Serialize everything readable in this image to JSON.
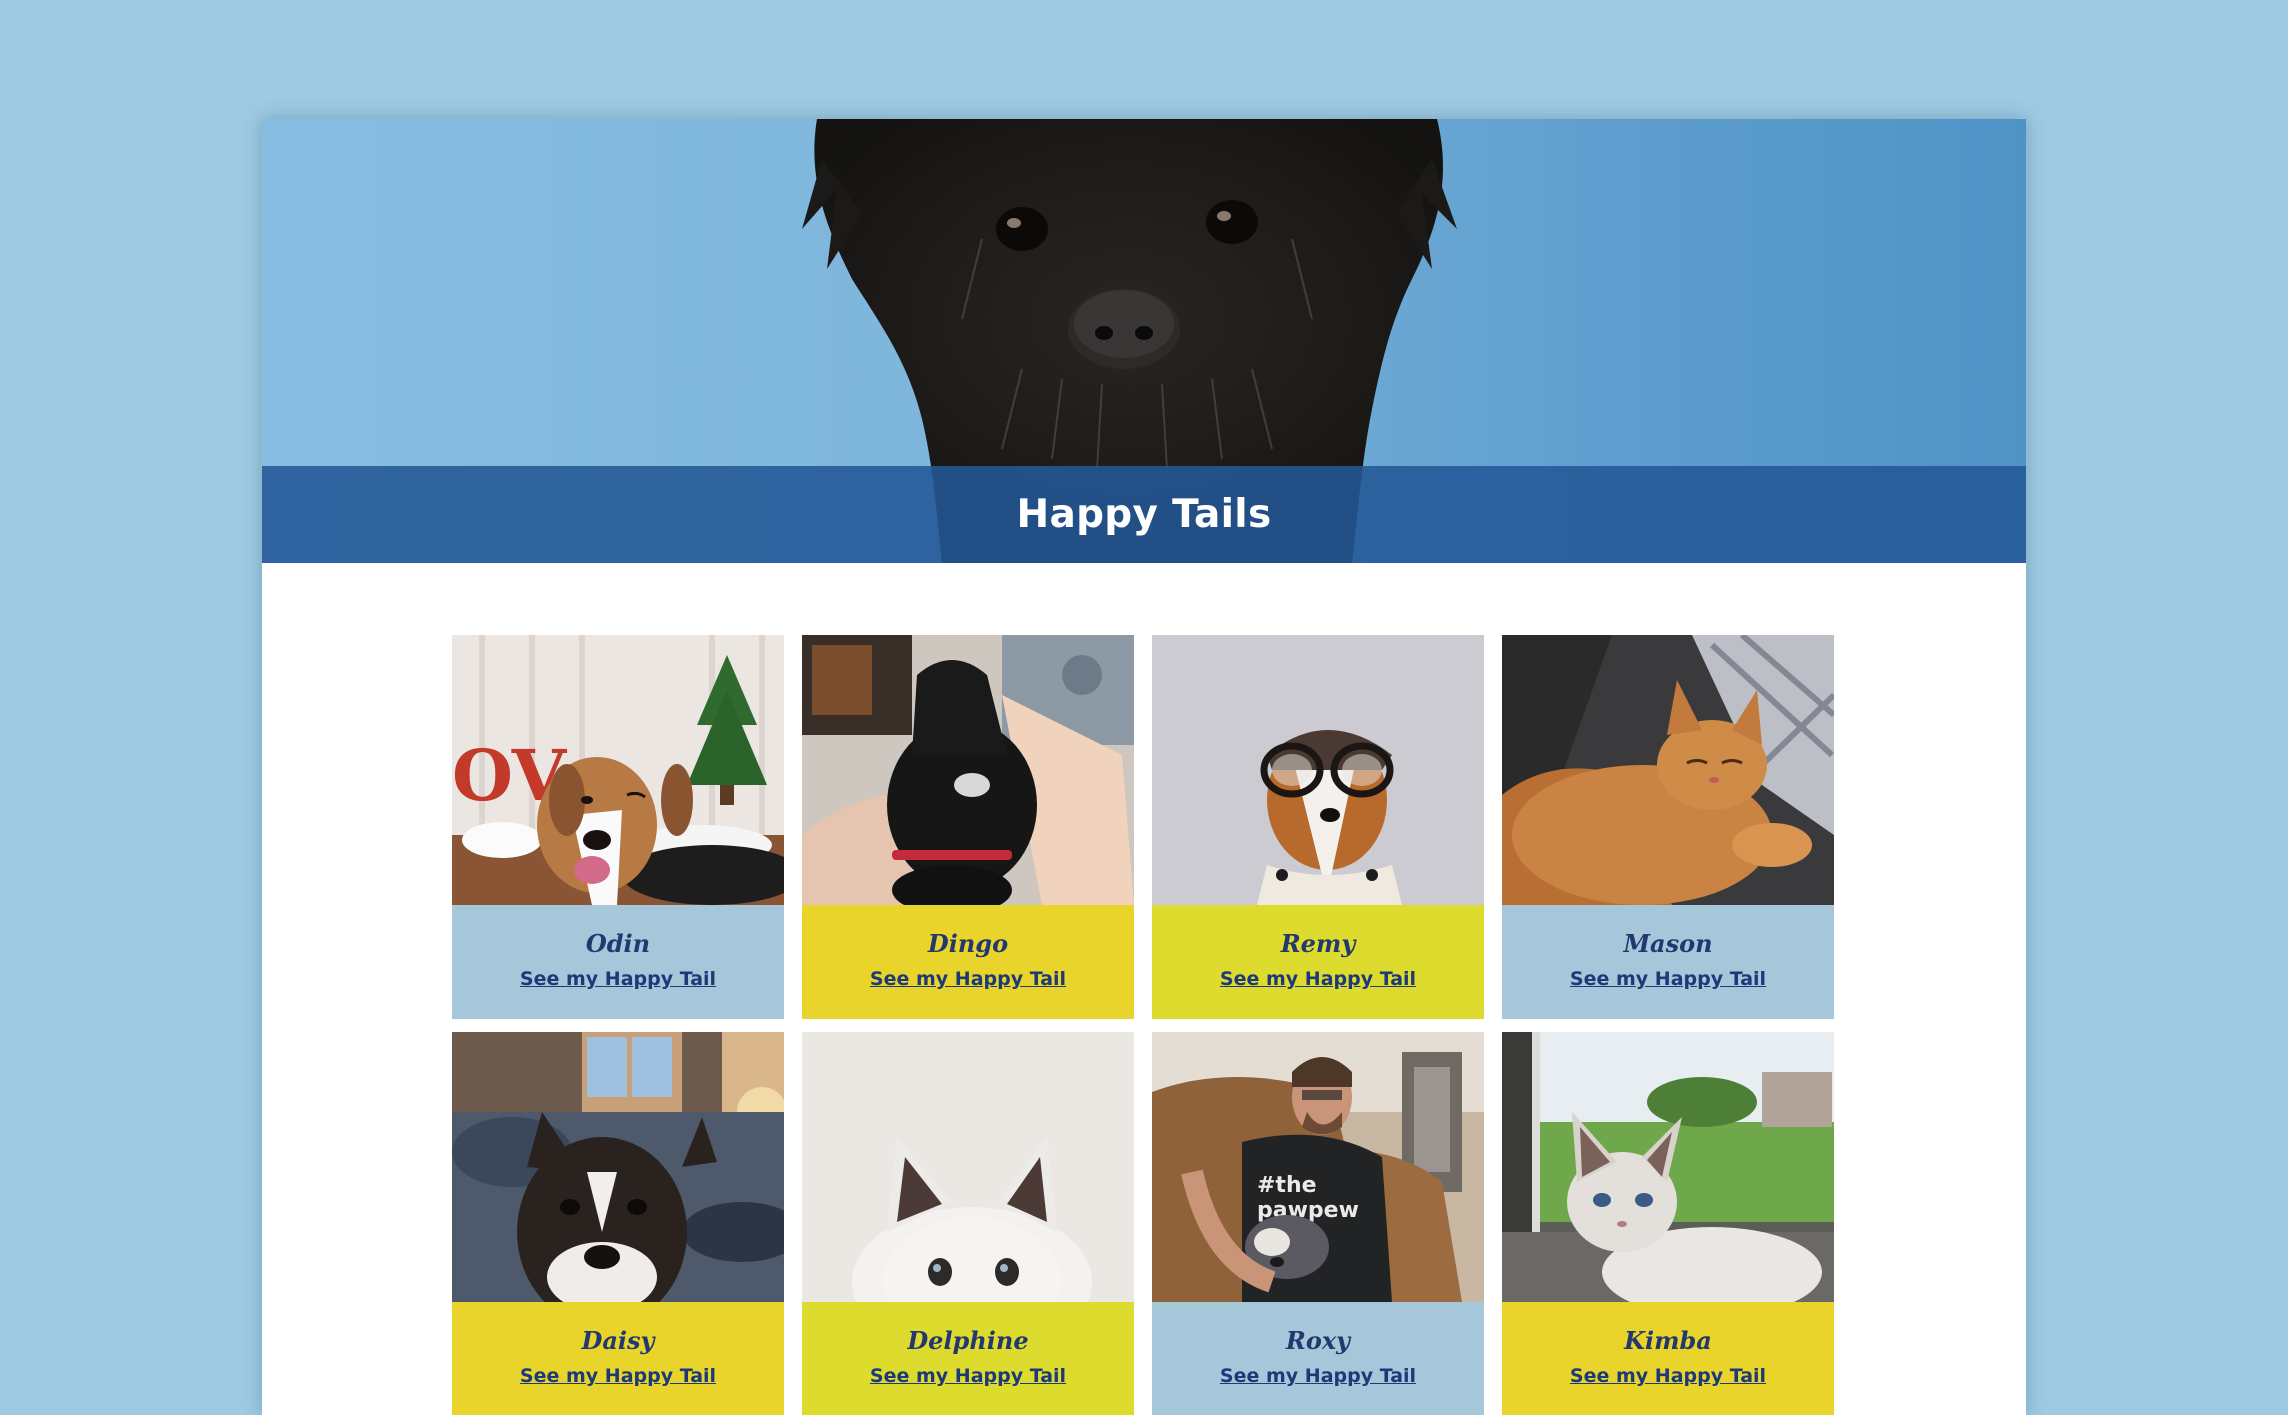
{
  "page": {
    "title": "Happy Tails"
  },
  "pets": [
    {
      "name": "Odin",
      "link_label": "See my Happy Tail",
      "caption_color": "#a6c6da",
      "photo": "beagle-christmas-photo"
    },
    {
      "name": "Dingo",
      "link_label": "See my Happy Tail",
      "caption_color": "#e8d42a",
      "photo": "black-dog-lap-photo"
    },
    {
      "name": "Remy",
      "link_label": "See my Happy Tail",
      "caption_color": "#dedb2f",
      "photo": "dog-with-glasses-photo"
    },
    {
      "name": "Mason",
      "link_label": "See my Happy Tail",
      "caption_color": "#a6c6da",
      "photo": "orange-cat-blanket-photo"
    },
    {
      "name": "Daisy",
      "link_label": "See my Happy Tail",
      "caption_color": "#e8d42a",
      "photo": "boston-terrier-photo"
    },
    {
      "name": "Delphine",
      "link_label": "See my Happy Tail",
      "caption_color": "#dedb2f",
      "photo": "white-kitten-photo"
    },
    {
      "name": "Roxy",
      "link_label": "See my Happy Tail",
      "caption_color": "#a6c6da",
      "photo": "man-with-dog-photo"
    },
    {
      "name": "Kimba",
      "link_label": "See my Happy Tail",
      "caption_color": "#e8d42a",
      "photo": "kitten-by-window-photo"
    }
  ]
}
